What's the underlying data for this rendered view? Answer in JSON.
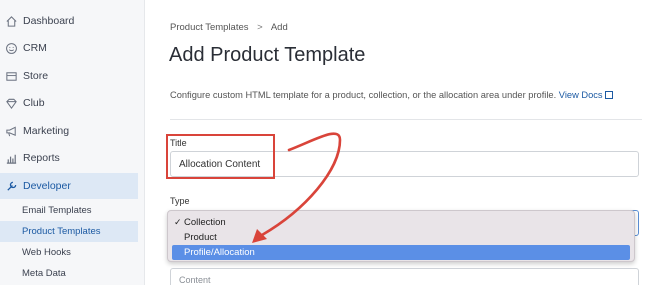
{
  "sidebar": {
    "items": [
      {
        "label": "Dashboard",
        "icon": "home-icon"
      },
      {
        "label": "CRM",
        "icon": "smile-icon"
      },
      {
        "label": "Store",
        "icon": "store-icon"
      },
      {
        "label": "Club",
        "icon": "diamond-icon"
      },
      {
        "label": "Marketing",
        "icon": "megaphone-icon"
      },
      {
        "label": "Reports",
        "icon": "bar-chart-icon"
      },
      {
        "label": "Developer",
        "icon": "wrench-icon",
        "active": true
      }
    ],
    "sub_items": [
      {
        "label": "Email Templates"
      },
      {
        "label": "Product Templates",
        "active": true
      },
      {
        "label": "Web Hooks"
      },
      {
        "label": "Meta Data"
      }
    ]
  },
  "breadcrumb": {
    "parent": "Product Templates",
    "separator": ">",
    "current": "Add"
  },
  "page_title": "Add Product Template",
  "description": {
    "text": "Configure custom HTML template for a product, collection, or the allocation area under profile.",
    "link": "View Docs"
  },
  "form": {
    "title_label": "Title",
    "title_value": "Allocation Content",
    "type_label": "Type",
    "type_options": [
      {
        "label": "Collection",
        "checked": true
      },
      {
        "label": "Product"
      },
      {
        "label": "Profile/Allocation",
        "highlighted": true
      }
    ],
    "content_placeholder": "Content"
  },
  "colors": {
    "accent": "#1c5aa3",
    "annotation": "#d9443a",
    "highlight": "#5b8fe6"
  }
}
